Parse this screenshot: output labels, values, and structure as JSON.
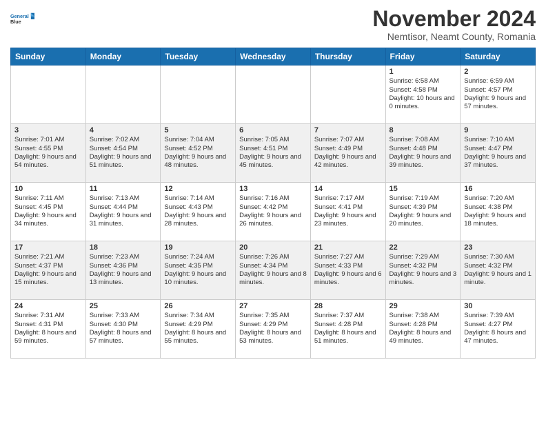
{
  "logo": {
    "line1": "General",
    "line2": "Blue"
  },
  "title": "November 2024",
  "subtitle": "Nemtisor, Neamt County, Romania",
  "headers": [
    "Sunday",
    "Monday",
    "Tuesday",
    "Wednesday",
    "Thursday",
    "Friday",
    "Saturday"
  ],
  "weeks": [
    [
      {
        "day": "",
        "info": ""
      },
      {
        "day": "",
        "info": ""
      },
      {
        "day": "",
        "info": ""
      },
      {
        "day": "",
        "info": ""
      },
      {
        "day": "",
        "info": ""
      },
      {
        "day": "1",
        "info": "Sunrise: 6:58 AM\nSunset: 4:58 PM\nDaylight: 10 hours and 0 minutes."
      },
      {
        "day": "2",
        "info": "Sunrise: 6:59 AM\nSunset: 4:57 PM\nDaylight: 9 hours and 57 minutes."
      }
    ],
    [
      {
        "day": "3",
        "info": "Sunrise: 7:01 AM\nSunset: 4:55 PM\nDaylight: 9 hours and 54 minutes."
      },
      {
        "day": "4",
        "info": "Sunrise: 7:02 AM\nSunset: 4:54 PM\nDaylight: 9 hours and 51 minutes."
      },
      {
        "day": "5",
        "info": "Sunrise: 7:04 AM\nSunset: 4:52 PM\nDaylight: 9 hours and 48 minutes."
      },
      {
        "day": "6",
        "info": "Sunrise: 7:05 AM\nSunset: 4:51 PM\nDaylight: 9 hours and 45 minutes."
      },
      {
        "day": "7",
        "info": "Sunrise: 7:07 AM\nSunset: 4:49 PM\nDaylight: 9 hours and 42 minutes."
      },
      {
        "day": "8",
        "info": "Sunrise: 7:08 AM\nSunset: 4:48 PM\nDaylight: 9 hours and 39 minutes."
      },
      {
        "day": "9",
        "info": "Sunrise: 7:10 AM\nSunset: 4:47 PM\nDaylight: 9 hours and 37 minutes."
      }
    ],
    [
      {
        "day": "10",
        "info": "Sunrise: 7:11 AM\nSunset: 4:45 PM\nDaylight: 9 hours and 34 minutes."
      },
      {
        "day": "11",
        "info": "Sunrise: 7:13 AM\nSunset: 4:44 PM\nDaylight: 9 hours and 31 minutes."
      },
      {
        "day": "12",
        "info": "Sunrise: 7:14 AM\nSunset: 4:43 PM\nDaylight: 9 hours and 28 minutes."
      },
      {
        "day": "13",
        "info": "Sunrise: 7:16 AM\nSunset: 4:42 PM\nDaylight: 9 hours and 26 minutes."
      },
      {
        "day": "14",
        "info": "Sunrise: 7:17 AM\nSunset: 4:41 PM\nDaylight: 9 hours and 23 minutes."
      },
      {
        "day": "15",
        "info": "Sunrise: 7:19 AM\nSunset: 4:39 PM\nDaylight: 9 hours and 20 minutes."
      },
      {
        "day": "16",
        "info": "Sunrise: 7:20 AM\nSunset: 4:38 PM\nDaylight: 9 hours and 18 minutes."
      }
    ],
    [
      {
        "day": "17",
        "info": "Sunrise: 7:21 AM\nSunset: 4:37 PM\nDaylight: 9 hours and 15 minutes."
      },
      {
        "day": "18",
        "info": "Sunrise: 7:23 AM\nSunset: 4:36 PM\nDaylight: 9 hours and 13 minutes."
      },
      {
        "day": "19",
        "info": "Sunrise: 7:24 AM\nSunset: 4:35 PM\nDaylight: 9 hours and 10 minutes."
      },
      {
        "day": "20",
        "info": "Sunrise: 7:26 AM\nSunset: 4:34 PM\nDaylight: 9 hours and 8 minutes."
      },
      {
        "day": "21",
        "info": "Sunrise: 7:27 AM\nSunset: 4:33 PM\nDaylight: 9 hours and 6 minutes."
      },
      {
        "day": "22",
        "info": "Sunrise: 7:29 AM\nSunset: 4:32 PM\nDaylight: 9 hours and 3 minutes."
      },
      {
        "day": "23",
        "info": "Sunrise: 7:30 AM\nSunset: 4:32 PM\nDaylight: 9 hours and 1 minute."
      }
    ],
    [
      {
        "day": "24",
        "info": "Sunrise: 7:31 AM\nSunset: 4:31 PM\nDaylight: 8 hours and 59 minutes."
      },
      {
        "day": "25",
        "info": "Sunrise: 7:33 AM\nSunset: 4:30 PM\nDaylight: 8 hours and 57 minutes."
      },
      {
        "day": "26",
        "info": "Sunrise: 7:34 AM\nSunset: 4:29 PM\nDaylight: 8 hours and 55 minutes."
      },
      {
        "day": "27",
        "info": "Sunrise: 7:35 AM\nSunset: 4:29 PM\nDaylight: 8 hours and 53 minutes."
      },
      {
        "day": "28",
        "info": "Sunrise: 7:37 AM\nSunset: 4:28 PM\nDaylight: 8 hours and 51 minutes."
      },
      {
        "day": "29",
        "info": "Sunrise: 7:38 AM\nSunset: 4:28 PM\nDaylight: 8 hours and 49 minutes."
      },
      {
        "day": "30",
        "info": "Sunrise: 7:39 AM\nSunset: 4:27 PM\nDaylight: 8 hours and 47 minutes."
      }
    ]
  ]
}
